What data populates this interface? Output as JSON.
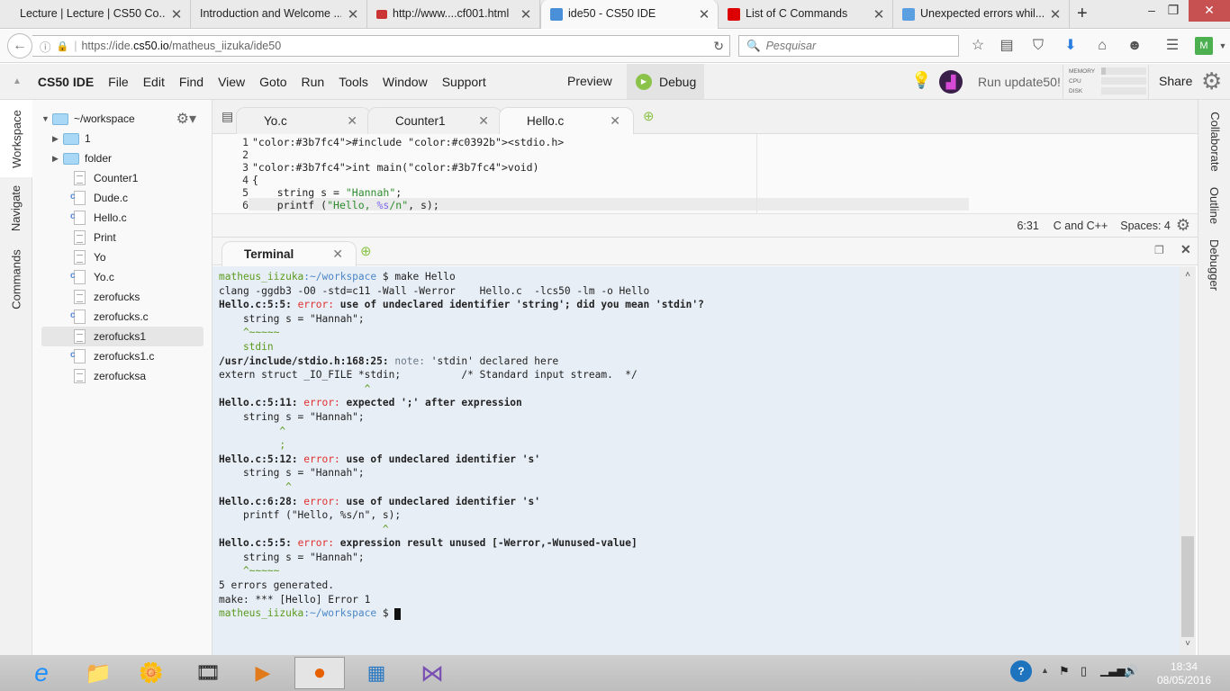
{
  "browser": {
    "tabs": [
      {
        "label": "Lecture | Lecture | CS50 Co...",
        "active": false
      },
      {
        "label": "Introduction and Welcome ...",
        "active": false
      },
      {
        "label": "http://www....cf001.html",
        "active": false
      },
      {
        "label": "ide50 - CS50 IDE",
        "active": true
      },
      {
        "label": "List of C Commands",
        "active": false
      },
      {
        "label": "Unexpected errors whil...",
        "active": false
      }
    ],
    "url": "https://ide.cs50.io/matheus_iizuka/ide50",
    "url_prefix": "https://ide.",
    "url_domain": "cs50.io",
    "url_path": "/matheus_iizuka/ide50",
    "search_placeholder": "Pesquisar",
    "new_tab_label": "+"
  },
  "ide": {
    "brand": "CS50 IDE",
    "menu": [
      "File",
      "Edit",
      "Find",
      "View",
      "Goto",
      "Run",
      "Tools",
      "Window",
      "Support"
    ],
    "preview_label": "Preview",
    "debug_label": "Debug",
    "update_label": "Run update50!",
    "share_label": "Share",
    "meters": [
      {
        "label": "MEMORY",
        "value": 0.1
      },
      {
        "label": "CPU",
        "value": 0
      },
      {
        "label": "DISK",
        "value": 0
      }
    ],
    "left_tabs": [
      "Workspace",
      "Navigate",
      "Commands"
    ],
    "right_tabs": [
      "Collaborate",
      "Outline",
      "Debugger"
    ],
    "tree": {
      "root": "~/workspace",
      "items": [
        {
          "name": "1",
          "type": "folder"
        },
        {
          "name": "folder",
          "type": "folder"
        },
        {
          "name": "Counter1",
          "type": "file"
        },
        {
          "name": "Dude.c",
          "type": "c"
        },
        {
          "name": "Hello.c",
          "type": "c"
        },
        {
          "name": "Print",
          "type": "file"
        },
        {
          "name": "Yo",
          "type": "file"
        },
        {
          "name": "Yo.c",
          "type": "c"
        },
        {
          "name": "zerofucks",
          "type": "file"
        },
        {
          "name": "zerofucks.c",
          "type": "c"
        },
        {
          "name": "zerofucks1",
          "type": "file",
          "selected": true
        },
        {
          "name": "zerofucks1.c",
          "type": "c"
        },
        {
          "name": "zerofucksa",
          "type": "file"
        }
      ]
    },
    "editor_tabs": [
      {
        "label": "Yo.c",
        "active": false
      },
      {
        "label": "Counter1",
        "active": false
      },
      {
        "label": "Hello.c",
        "active": true
      }
    ],
    "code_lines": [
      "#include <stdio.h>",
      "",
      "int main(void)",
      "{",
      "    string s = \"Hannah\";",
      "    printf (\"Hello, %s/n\", s);",
      "}"
    ],
    "status": {
      "position": "6:31",
      "language": "C and C++",
      "spaces": "Spaces: 4"
    },
    "terminal_tab": "Terminal",
    "terminal_lines": [
      [
        {
          "t": "matheus_iizuka",
          "c": "g"
        },
        {
          "t": ":~/workspace",
          "c": "b"
        },
        {
          "t": " $ make Hello",
          "c": ""
        }
      ],
      [
        {
          "t": "clang -ggdb3 -O0 -std=c11 -Wall -Werror    Hello.c  -lcs50 -lm -o Hello",
          "c": ""
        }
      ],
      [
        {
          "t": "Hello.c:5:5: ",
          "c": "bd"
        },
        {
          "t": "error:",
          "c": "r"
        },
        {
          "t": " use of undeclared identifier 'string'; did you mean 'stdin'?",
          "c": "bd"
        }
      ],
      [
        {
          "t": "    string s = \"Hannah\";",
          "c": ""
        }
      ],
      [
        {
          "t": "    ^~~~~~",
          "c": "g"
        }
      ],
      [
        {
          "t": "    stdin",
          "c": "g"
        }
      ],
      [
        {
          "t": "/usr/include/stdio.h:168:25: ",
          "c": "bd"
        },
        {
          "t": "note:",
          "c": "n"
        },
        {
          "t": " 'stdin' declared here",
          "c": ""
        }
      ],
      [
        {
          "t": "extern struct _IO_FILE *stdin;          /* Standard input stream.  */",
          "c": ""
        }
      ],
      [
        {
          "t": "                        ^",
          "c": "g"
        }
      ],
      [
        {
          "t": "Hello.c:5:11: ",
          "c": "bd"
        },
        {
          "t": "error:",
          "c": "r"
        },
        {
          "t": " expected ';' after expression",
          "c": "bd"
        }
      ],
      [
        {
          "t": "    string s = \"Hannah\";",
          "c": ""
        }
      ],
      [
        {
          "t": "          ^",
          "c": "g"
        }
      ],
      [
        {
          "t": "          ;",
          "c": "g"
        }
      ],
      [
        {
          "t": "Hello.c:5:12: ",
          "c": "bd"
        },
        {
          "t": "error:",
          "c": "r"
        },
        {
          "t": " use of undeclared identifier 's'",
          "c": "bd"
        }
      ],
      [
        {
          "t": "    string s = \"Hannah\";",
          "c": ""
        }
      ],
      [
        {
          "t": "           ^",
          "c": "g"
        }
      ],
      [
        {
          "t": "Hello.c:6:28: ",
          "c": "bd"
        },
        {
          "t": "error:",
          "c": "r"
        },
        {
          "t": " use of undeclared identifier 's'",
          "c": "bd"
        }
      ],
      [
        {
          "t": "    printf (\"Hello, %s/n\", s);",
          "c": ""
        }
      ],
      [
        {
          "t": "                           ^",
          "c": "g"
        }
      ],
      [
        {
          "t": "Hello.c:5:5: ",
          "c": "bd"
        },
        {
          "t": "error:",
          "c": "r"
        },
        {
          "t": " expression result unused [-Werror,-Wunused-value]",
          "c": "bd"
        }
      ],
      [
        {
          "t": "    string s = \"Hannah\";",
          "c": ""
        }
      ],
      [
        {
          "t": "    ^~~~~~",
          "c": "g"
        }
      ],
      [
        {
          "t": "5 errors generated.",
          "c": ""
        }
      ],
      [
        {
          "t": "make: *** [Hello] Error 1",
          "c": ""
        }
      ],
      [
        {
          "t": "matheus_iizuka",
          "c": "g"
        },
        {
          "t": ":~/workspace",
          "c": "b"
        },
        {
          "t": " $ ",
          "c": ""
        }
      ]
    ]
  },
  "taskbar": {
    "apps": [
      "internet-explorer",
      "file-explorer",
      "photo-gallery",
      "movie-maker",
      "media-player",
      "firefox",
      "control-panel",
      "visual-studio"
    ],
    "time": "18:34",
    "date": "08/05/2016"
  }
}
